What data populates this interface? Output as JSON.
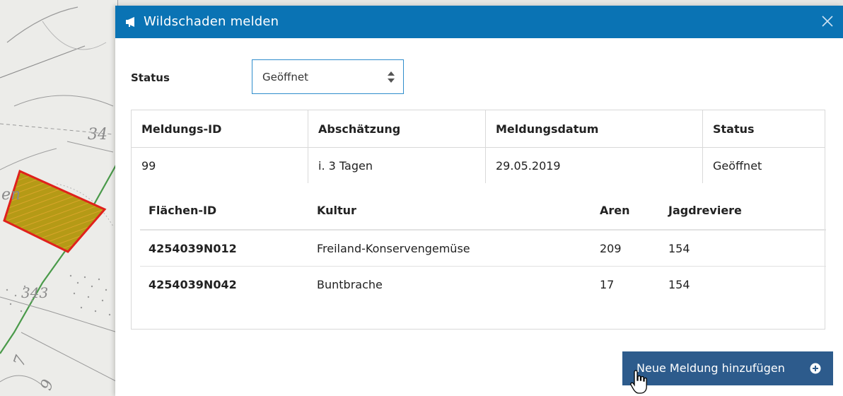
{
  "map": {
    "labels": [
      "34",
      "en",
      "343",
      "7",
      "9"
    ],
    "parcel_fill": "#b59a16",
    "parcel_border": "#e0211c"
  },
  "dialog": {
    "title": "Wildschaden melden",
    "header_color": "#0a73b4",
    "icons": {
      "title": "megaphone-icon",
      "close": "close-icon"
    }
  },
  "status_filter": {
    "label": "Status",
    "selected": "Geöffnet"
  },
  "report_table": {
    "columns": [
      "Meldungs-ID",
      "Abschätzung",
      "Meldungsdatum",
      "Status"
    ],
    "rows": [
      {
        "id": "99",
        "estimate": "i. 3 Tagen",
        "date": "29.05.2019",
        "status": "Geöffnet"
      }
    ]
  },
  "area_table": {
    "columns": [
      "Flächen-ID",
      "Kultur",
      "Aren",
      "Jagdreviere"
    ],
    "rows": [
      {
        "id": "4254039N012",
        "culture": "Freiland-Konservengemüse",
        "aren": "209",
        "reviere": "154"
      },
      {
        "id": "4254039N042",
        "culture": "Buntbrache",
        "aren": "17",
        "reviere": "154"
      }
    ]
  },
  "actions": {
    "new_report_label": "Neue Meldung hinzufügen",
    "new_report_icon": "plus-circle-icon",
    "button_color": "#2d5b8c"
  }
}
